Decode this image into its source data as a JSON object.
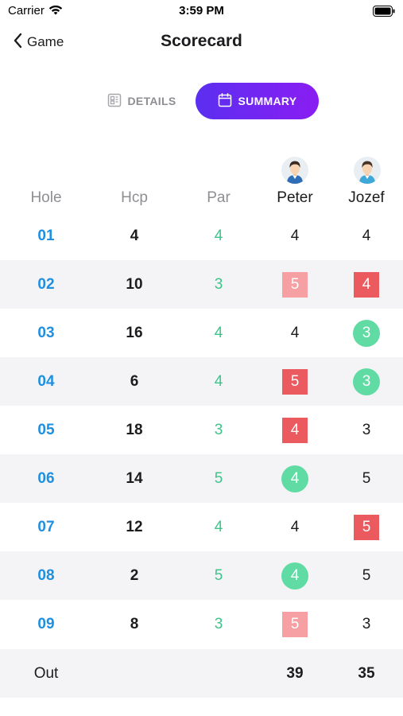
{
  "status_bar": {
    "carrier": "Carrier",
    "time": "3:59 PM"
  },
  "nav": {
    "back_label": "Game",
    "title": "Scorecard"
  },
  "tabs": [
    {
      "label": "DETAILS",
      "icon": "details-icon",
      "active": false
    },
    {
      "label": "SUMMARY",
      "icon": "calendar-icon",
      "active": true
    }
  ],
  "columns": {
    "hole": "Hole",
    "hcp": "Hcp",
    "par": "Par"
  },
  "players": [
    {
      "name": "Peter",
      "avatar": "avatar-icon"
    },
    {
      "name": "Jozef",
      "avatar": "avatar-icon"
    }
  ],
  "holes": [
    {
      "hole": "01",
      "hcp": "4",
      "par": "4",
      "scores": [
        {
          "value": "4",
          "style": "plain"
        },
        {
          "value": "4",
          "style": "plain"
        }
      ]
    },
    {
      "hole": "02",
      "hcp": "10",
      "par": "3",
      "scores": [
        {
          "value": "5",
          "style": "bogey"
        },
        {
          "value": "4",
          "style": "double"
        }
      ]
    },
    {
      "hole": "03",
      "hcp": "16",
      "par": "4",
      "scores": [
        {
          "value": "4",
          "style": "plain"
        },
        {
          "value": "3",
          "style": "birdie"
        }
      ]
    },
    {
      "hole": "04",
      "hcp": "6",
      "par": "4",
      "scores": [
        {
          "value": "5",
          "style": "double"
        },
        {
          "value": "3",
          "style": "birdie"
        }
      ]
    },
    {
      "hole": "05",
      "hcp": "18",
      "par": "3",
      "scores": [
        {
          "value": "4",
          "style": "double"
        },
        {
          "value": "3",
          "style": "plain"
        }
      ]
    },
    {
      "hole": "06",
      "hcp": "14",
      "par": "5",
      "scores": [
        {
          "value": "4",
          "style": "birdie"
        },
        {
          "value": "5",
          "style": "plain"
        }
      ]
    },
    {
      "hole": "07",
      "hcp": "12",
      "par": "4",
      "scores": [
        {
          "value": "4",
          "style": "plain"
        },
        {
          "value": "5",
          "style": "double"
        }
      ]
    },
    {
      "hole": "08",
      "hcp": "2",
      "par": "5",
      "scores": [
        {
          "value": "4",
          "style": "birdie"
        },
        {
          "value": "5",
          "style": "plain"
        }
      ]
    },
    {
      "hole": "09",
      "hcp": "8",
      "par": "3",
      "scores": [
        {
          "value": "5",
          "style": "bogey"
        },
        {
          "value": "3",
          "style": "plain"
        }
      ]
    }
  ],
  "totals": {
    "label": "Out",
    "values": [
      "39",
      "35"
    ]
  },
  "colors": {
    "accent_gradient_start": "#5b2ff0",
    "accent_gradient_end": "#8a1df2",
    "hole_blue": "#1f8fe0",
    "par_green": "#3ec48a",
    "birdie_green": "#5fdba3",
    "bogey_pink": "#f6a0a3",
    "double_red": "#ea5a5f"
  }
}
